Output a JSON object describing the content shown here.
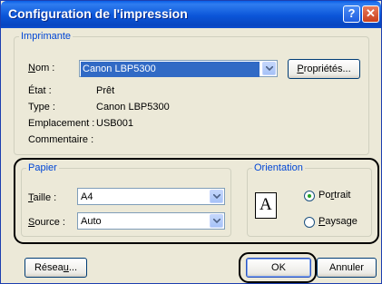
{
  "window": {
    "title": "Configuration de l'impression",
    "help_glyph": "?",
    "close_glyph": "✕"
  },
  "printer": {
    "group_label": "Imprimante",
    "name_label_u": "N",
    "name_label_rest": "om :",
    "name_value": "Canon LBP5300",
    "properties_u": "P",
    "properties_rest": "ropriétés...",
    "status_label": "État :",
    "status_value": "Prêt",
    "type_label": "Type :",
    "type_value": "Canon LBP5300",
    "location_label": "Emplacement :",
    "location_value": "USB001",
    "comment_label": "Commentaire :"
  },
  "paper": {
    "group_label": "Papier",
    "size_label_u": "T",
    "size_label_rest": "aille :",
    "size_value": "A4",
    "source_label_u": "S",
    "source_label_rest": "ource :",
    "source_value": "Auto"
  },
  "orientation": {
    "group_label": "Orientation",
    "icon_letter": "A",
    "portrait_pre": "Po",
    "portrait_u": "r",
    "portrait_post": "trait",
    "portrait_selected": true,
    "landscape_u": "P",
    "landscape_rest": "aysage",
    "landscape_selected": false
  },
  "footer": {
    "network_pre": "Résea",
    "network_u": "u",
    "network_post": "...",
    "ok_label": "OK",
    "cancel_label": "Annuler"
  }
}
